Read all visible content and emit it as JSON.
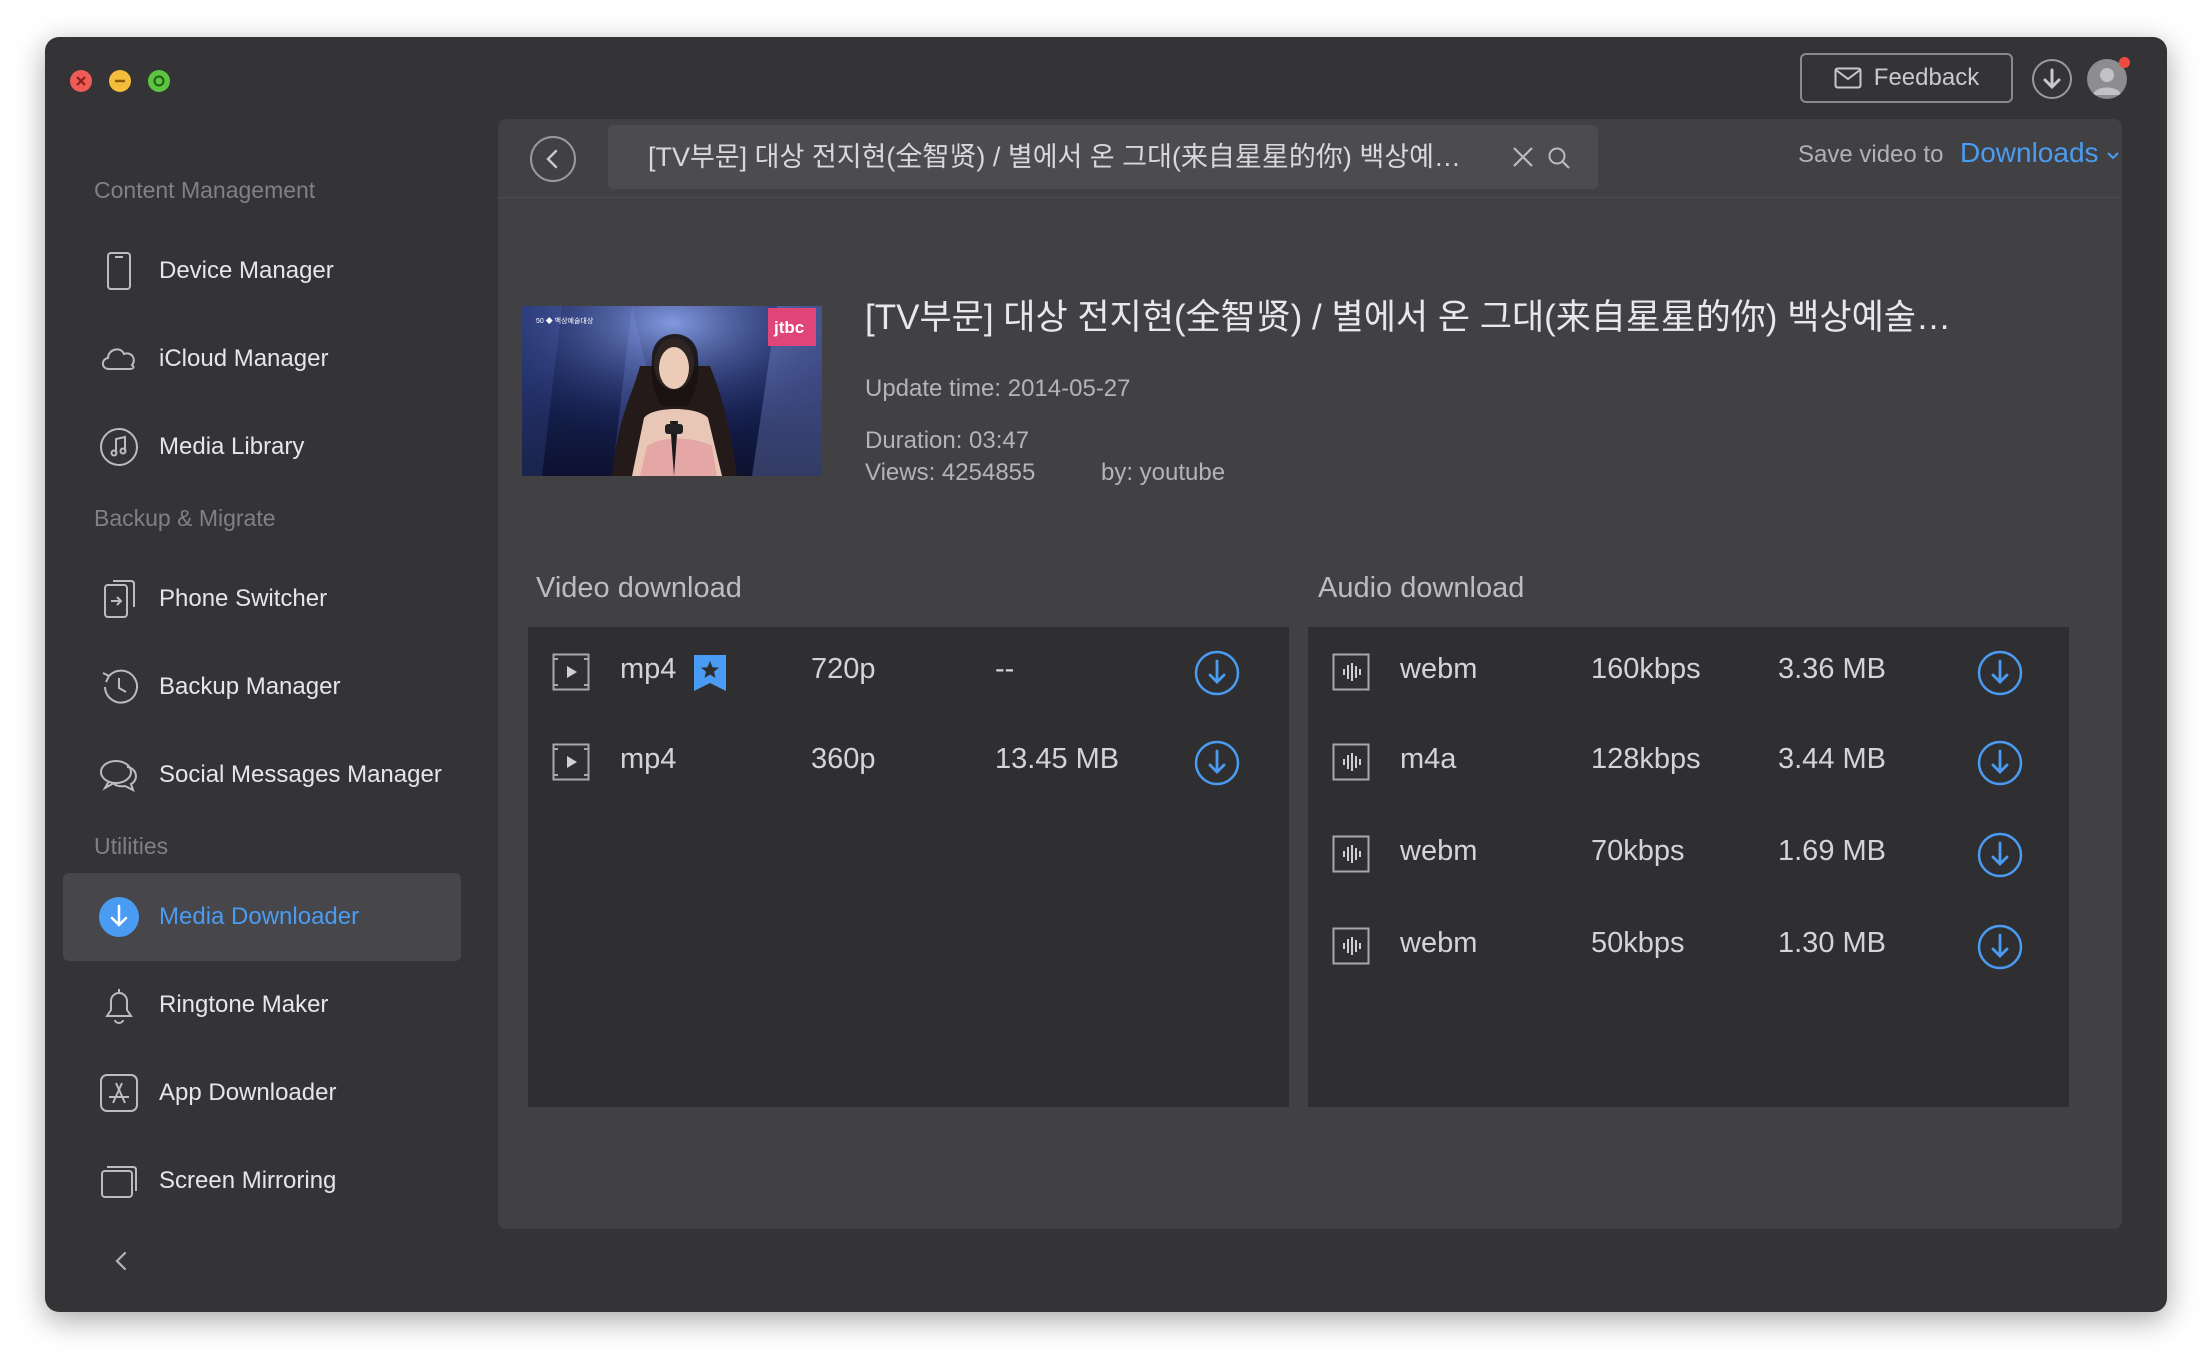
{
  "titlebar": {
    "feedback_label": "Feedback"
  },
  "sidebar": {
    "sections": [
      {
        "title": "Content Management",
        "items": [
          {
            "label": "Device Manager",
            "icon": "device-icon"
          },
          {
            "label": "iCloud Manager",
            "icon": "cloud-icon"
          },
          {
            "label": "Media Library",
            "icon": "music-icon"
          }
        ]
      },
      {
        "title": "Backup & Migrate",
        "items": [
          {
            "label": "Phone Switcher",
            "icon": "phone-switch-icon"
          },
          {
            "label": "Backup Manager",
            "icon": "history-icon"
          },
          {
            "label": "Social Messages Manager",
            "icon": "chat-icon"
          }
        ]
      },
      {
        "title": "Utilities",
        "items": [
          {
            "label": "Media Downloader",
            "icon": "download-icon",
            "active": true
          },
          {
            "label": "Ringtone Maker",
            "icon": "bell-icon"
          },
          {
            "label": "App Downloader",
            "icon": "app-store-icon"
          },
          {
            "label": "Screen Mirroring",
            "icon": "screen-icon"
          }
        ]
      }
    ]
  },
  "toolbar": {
    "search_value": "[TV부문] 대상 전지현(全智贤) / 별에서 온 그대(来自星星的你) 백상예…",
    "save_label": "Save video to",
    "save_target": "Downloads"
  },
  "video": {
    "title": "[TV부문] 대상 전지현(全智贤) / 별에서 온 그대(来自星星的你) 백상예술대…",
    "update_time": "Update time: 2014-05-27",
    "duration": "Duration: 03:47",
    "views": "Views: 4254855",
    "by": "by: youtube",
    "thumbnail_logo": "jtbc"
  },
  "video_download": {
    "title": "Video download",
    "rows": [
      {
        "format": "mp4",
        "quality": "720p",
        "size": "--",
        "recommended": true
      },
      {
        "format": "mp4",
        "quality": "360p",
        "size": "13.45 MB",
        "recommended": false
      }
    ]
  },
  "audio_download": {
    "title": "Audio download",
    "rows": [
      {
        "format": "webm",
        "bitrate": "160kbps",
        "size": "3.36 MB"
      },
      {
        "format": "m4a",
        "bitrate": "128kbps",
        "size": "3.44 MB"
      },
      {
        "format": "webm",
        "bitrate": "70kbps",
        "size": "1.69 MB"
      },
      {
        "format": "webm",
        "bitrate": "50kbps",
        "size": "1.30 MB"
      }
    ]
  },
  "colors": {
    "accent": "#4a9cf2",
    "window_bg": "#343437",
    "panel_bg": "#414144",
    "list_bg": "#2f2f32"
  }
}
